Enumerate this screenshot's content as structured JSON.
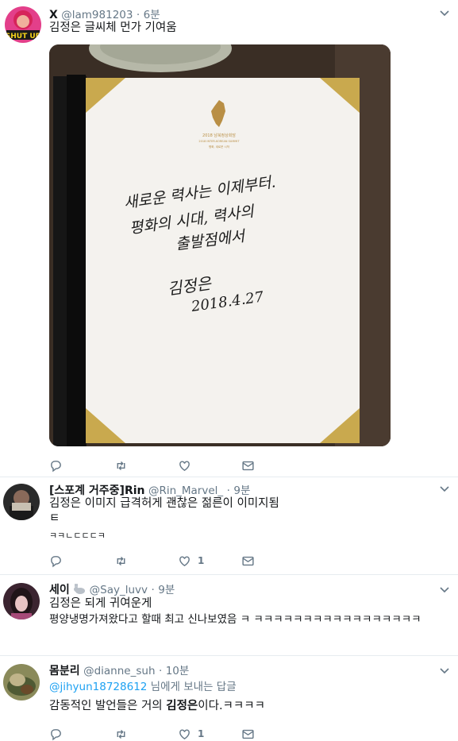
{
  "tweets": [
    {
      "name": "X",
      "handle": "@lam981203",
      "time": "6분",
      "text": "김정은 글씨체 먼가 기여움",
      "avatar_text": "SHUT UP",
      "photo": {
        "logo_year_text": "2018 남북정상회담",
        "logo_en_text": "2018 INTER-KOREAN SUMMIT",
        "logo_small_text": "평화, 새로운 시작",
        "note_line1": "새로운 력사는 이제부터.",
        "note_line2": "평화의 시대, 력사의",
        "note_line3": "출발점에서",
        "signature": "김정은",
        "date": "2018.4.27"
      },
      "likes": "",
      "icons": [
        "reply-icon",
        "retweet-icon",
        "like-icon",
        "message-icon"
      ]
    },
    {
      "name": "[스포계 거주중]Rin",
      "handle": "@Rin_Marvel_",
      "time": "9분",
      "text_lines": [
        "김정은 이미지 급격허게 괜찮은 젊른이 이미지됨",
        "ㅌ",
        "ㅋㅋㄴㄷㄷㄷㅋ"
      ],
      "likes": "1"
    },
    {
      "name": "세이",
      "handle": "@Say_luvv",
      "time": "9분",
      "text_lines": [
        "김정은 되게 귀여운게",
        "평양냉명가져왔다고 할때 최고 신나보였음 ㅋ ㅋㅋㅋㅋㅋㅋㅋㅋㅋㅋㅋㅋㅋㅋㅋㅋㅋ"
      ],
      "likes": ""
    },
    {
      "name": "몸분리",
      "handle": "@dianne_suh",
      "time": "10분",
      "reply_mention": "@jihyun18728612",
      "reply_suffix": " 님에게 보내는 답글",
      "text_pre": "감동적인 발언들은 거의 ",
      "text_bold": "김정은",
      "text_post": "이다.ㅋㅋㅋㅋ",
      "likes": "1"
    }
  ],
  "separator_dot": "·",
  "colors": {
    "accent": "#1da1f2",
    "muted": "#657786",
    "text": "#14171a",
    "divider": "#e6ecf0"
  }
}
